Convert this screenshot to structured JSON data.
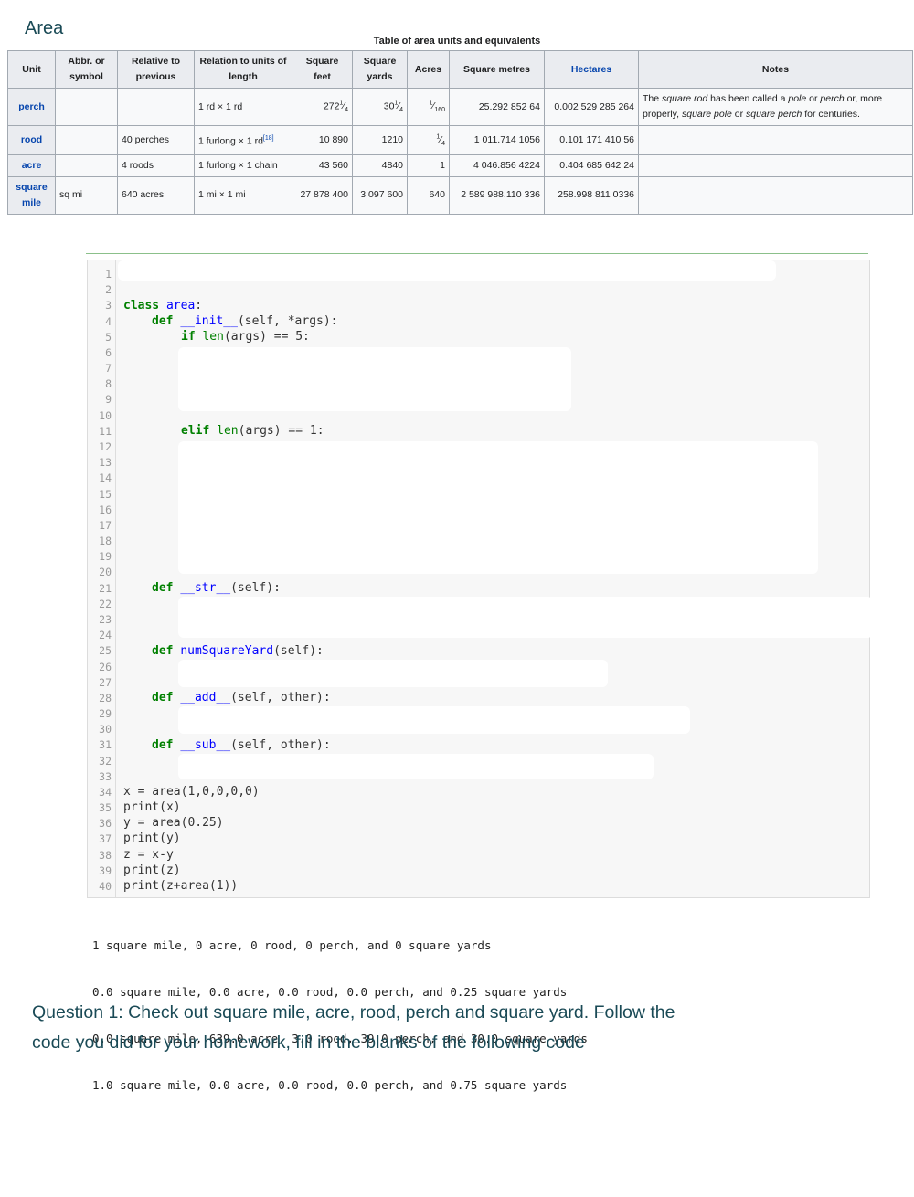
{
  "heading": "Area",
  "table": {
    "caption": "Table of area units and equivalents",
    "headers": [
      "Unit",
      "Abbr. or symbol",
      "Relative to previous",
      "Relation to units of length",
      "Square feet",
      "Square yards",
      "Acres",
      "Square metres",
      "Hectares",
      "Notes"
    ],
    "rows": [
      {
        "unit": "perch",
        "abbr": "",
        "relative": "",
        "relation": "1 rd × 1 rd",
        "relation_ref": "",
        "sq_feet_whole": "272",
        "sq_feet_frac_num": "1",
        "sq_feet_frac_den": "4",
        "sq_yards_whole": "30",
        "sq_yards_frac_num": "1",
        "sq_yards_frac_den": "4",
        "acres_frac_num": "1",
        "acres_frac_den": "160",
        "sq_metres": "25.292 852 64",
        "hectares": "0.002 529 285 264",
        "notes_parts": [
          "The ",
          "square rod",
          " has been called a ",
          "pole",
          " or ",
          "perch",
          " or, more properly, ",
          "square pole",
          " or ",
          "square perch",
          " for centuries."
        ]
      },
      {
        "unit": "rood",
        "abbr": "",
        "relative": "40 perches",
        "relation": "1 furlong × 1 rd",
        "relation_ref": "[18]",
        "sq_feet": "10 890",
        "sq_yards": "1210",
        "acres_frac_num": "1",
        "acres_frac_den": "4",
        "sq_metres": "1 011.714 1056",
        "hectares": "0.101 171 410 56",
        "notes": ""
      },
      {
        "unit": "acre",
        "abbr": "",
        "relative": "4 roods",
        "relation": "1 furlong × 1 chain",
        "sq_feet": "43 560",
        "sq_yards": "4840",
        "acres": "1",
        "sq_metres": "4 046.856 4224",
        "hectares": "0.404 685 642 24",
        "notes": ""
      },
      {
        "unit": "square mile",
        "abbr": "sq mi",
        "relative": "640 acres",
        "relation": "1 mi × 1 mi",
        "sq_feet": "27 878 400",
        "sq_yards": "3 097 600",
        "acres": "640",
        "sq_metres": "2 589 988.110 336",
        "hectares": "258.998 811 0336",
        "notes": ""
      }
    ]
  },
  "code": {
    "line_numbers": [
      "1",
      "2",
      "3",
      "4",
      "5",
      "6",
      "7",
      "8",
      "9",
      "10",
      "11",
      "12",
      "13",
      "14",
      "15",
      "16",
      "17",
      "18",
      "19",
      "20",
      "21",
      "22",
      "23",
      "24",
      "25",
      "26",
      "27",
      "28",
      "29",
      "30",
      "31",
      "32",
      "33",
      "34",
      "35",
      "36",
      "37",
      "38",
      "39",
      "40"
    ],
    "l3_kw": "class",
    "l3_name": "area",
    "l3_rest": ":",
    "l4_kw": "def",
    "l4_name": "__init__",
    "l4_rest": "(self, *args):",
    "l5_kw": "if",
    "l5_fn": "len",
    "l5_rest": "(args) == 5:",
    "l11_kw": "elif",
    "l11_fn": "len",
    "l11_rest": "(args) == 1:",
    "l21_kw": "def",
    "l21_name": "__str__",
    "l21_rest": "(self):",
    "l25_kw": "def",
    "l25_name": "numSquareYard",
    "l25_rest": "(self):",
    "l28_kw": "def",
    "l28_name": "__add__",
    "l28_rest": "(self, other):",
    "l31_kw": "def",
    "l31_name": "__sub__",
    "l31_rest": "(self, other):",
    "l34": "x = area(1,0,0,0,0)",
    "l35": "print(x)",
    "l36": "y = area(0.25)",
    "l37": "print(y)",
    "l38": "z = x-y",
    "l39": "print(z)",
    "l40": "print(z+area(1))"
  },
  "output_lines": [
    "1 square mile, 0 acre, 0 rood, 0 perch, and 0 square yards",
    "0.0 square mile, 0.0 acre, 0.0 rood, 0.0 perch, and 0.25 square yards",
    "0.0 square mile, 639.0 acre, 3.0 rood, 39.0 perch, and 30.0 square yards",
    "1.0 square mile, 0.0 acre, 0.0 rood, 0.0 perch, and 0.75 square yards"
  ],
  "question": "Question 1: Check out square mile, acre, rood, perch and square yard. Follow the code you did for your homework, fill in the blanks of the following code"
}
